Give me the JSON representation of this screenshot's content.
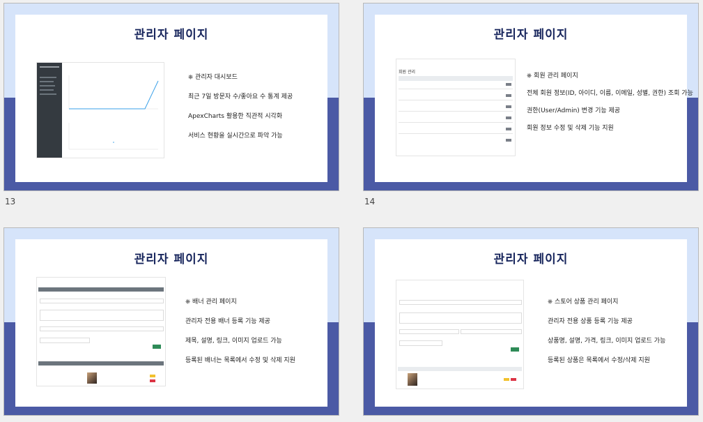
{
  "slides": [
    {
      "title": "관리자 페이지",
      "number": "13",
      "bullets": [
        "⎈ 관리자 대시보드",
        "최근 7일 방문자 수/좋아요 수 통계 제공",
        "ApexCharts 활용한 직관적 시각화",
        "서비스 현황을 실시간으로 파악 가능"
      ]
    },
    {
      "title": "관리자 페이지",
      "number": "14",
      "bullets": [
        "⎈ 회원 관리 페이지",
        "전체 회원 정보(ID, 아이디, 이름, 이메일, 성별, 권한) 조회 가능",
        "권한(User/Admin) 변경 기능 제공",
        "회원 정보 수정 및 삭제 기능 지원"
      ],
      "thumb_heading": "회원 관리"
    },
    {
      "title": "관리자 페이지",
      "bullets": [
        "⎈ 배너 관리 페이지",
        "관리자 전용 배너 등록 기능 제공",
        "제목, 설명, 링크, 이미지 업로드 가능",
        "등록된 배너는 목록에서 수정 및 삭제 지원"
      ]
    },
    {
      "title": "관리자 페이지",
      "bullets": [
        "⎈ 스토어 상품 관리 페이지",
        "관리자 전용 상품 등록 기능 제공",
        "상품명, 설명, 가격, 링크, 이미지 업로드 가능",
        "등록된 상품은 목록에서 수정/삭제 지원"
      ]
    }
  ]
}
